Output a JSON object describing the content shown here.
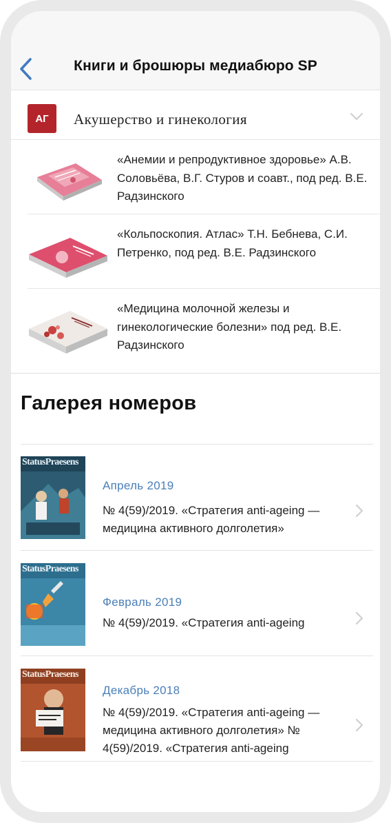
{
  "header": {
    "title": "Книги и брошюры медиабюро SP"
  },
  "category": {
    "logo_text": "АГ",
    "title": "Акушерство и гинекология"
  },
  "books": [
    {
      "title": "«Анемии и репродуктивное здоровье» А.В. Соловьёва, В.Г. Стуров и соавт., под ред. В.Е. Радзинского"
    },
    {
      "title": "«Кольпоскопия. Атлас» Т.Н. Бебнева, С.И. Петренко, под ред. В.Е. Радзинского"
    },
    {
      "title": "«Медицина молочной железы и гинекологические болезни» под ред. В.Е. Радзинского"
    }
  ],
  "gallery": {
    "title": "Галерея номеров",
    "issues": [
      {
        "date": "Апрель 2019",
        "title": "№ 4(59)/2019. «Стратегия anti-ageing — медицина активного долголетия»",
        "masthead": "StatusPraesens"
      },
      {
        "date": "Февраль 2019",
        "title": "№ 4(59)/2019. «Стратегия anti-ageing",
        "masthead": "StatusPraesens"
      },
      {
        "date": "Декабрь 2018",
        "title": "№ 4(59)/2019. «Стратегия anti-ageing — медицина активного долголетия» № 4(59)/2019. «Стратегия anti-ageing",
        "masthead": "StatusPraesens"
      }
    ]
  },
  "colors": {
    "accent": "#4a7fb8",
    "brand_red": "#b3252b",
    "header_bg": "#f7f7f7",
    "frame": "#e9e9e9"
  },
  "icons": {
    "back": "chevron-left-icon",
    "category_toggle": "chevron-down-icon",
    "issue_arrow": "chevron-right-icon"
  }
}
